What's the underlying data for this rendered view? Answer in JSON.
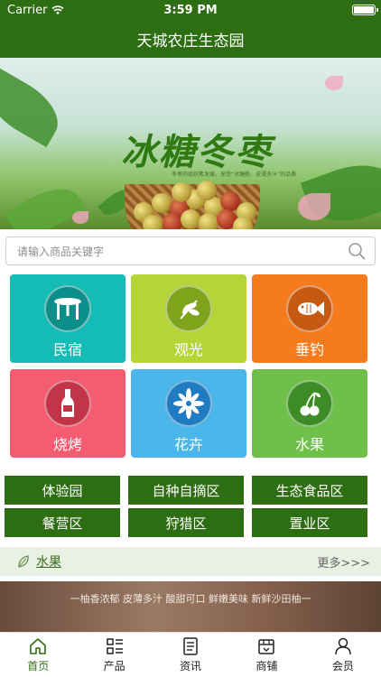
{
  "status": {
    "carrier": "Carrier",
    "time": "3:59 PM",
    "battery_level": 1.0
  },
  "header": {
    "title": "天城农庄生态园"
  },
  "banner": {
    "title": "冰糖冬枣",
    "subtitle": "冬枣的组织素发展，享受“冰糖脆，皮薄多汁”的品质"
  },
  "search": {
    "placeholder": "请输入商品关键字"
  },
  "categories": [
    {
      "label": "民宿",
      "icon": "table-icon",
      "color": "#14bcb5"
    },
    {
      "label": "观光",
      "icon": "leaf-icon",
      "color": "#b6d437"
    },
    {
      "label": "垂钓",
      "icon": "fish-icon",
      "color": "#f67b1d"
    },
    {
      "label": "烧烤",
      "icon": "bottle-icon",
      "color": "#f45c72"
    },
    {
      "label": "花卉",
      "icon": "flower-icon",
      "color": "#4bb6e9"
    },
    {
      "label": "水果",
      "icon": "cherry-icon",
      "color": "#6fc04a"
    }
  ],
  "zones": [
    "体验园",
    "自种自摘区",
    "生态食品区",
    "餐营区",
    "狩猎区",
    "置业区"
  ],
  "section": {
    "title": "水果",
    "more": "更多>>>"
  },
  "promo": {
    "text": "一柚香浓郁  皮薄多汁  酸甜可口  鲜嫩美味 新鲜沙田柚一"
  },
  "tabs": [
    {
      "label": "首页",
      "icon": "home-icon",
      "active": true
    },
    {
      "label": "产品",
      "icon": "grid-icon",
      "active": false
    },
    {
      "label": "资讯",
      "icon": "news-icon",
      "active": false
    },
    {
      "label": "商铺",
      "icon": "shop-icon",
      "active": false
    },
    {
      "label": "会员",
      "icon": "user-icon",
      "active": false
    }
  ],
  "colors": {
    "primary": "#2e6e12",
    "active_dot": "#e03a3a"
  }
}
